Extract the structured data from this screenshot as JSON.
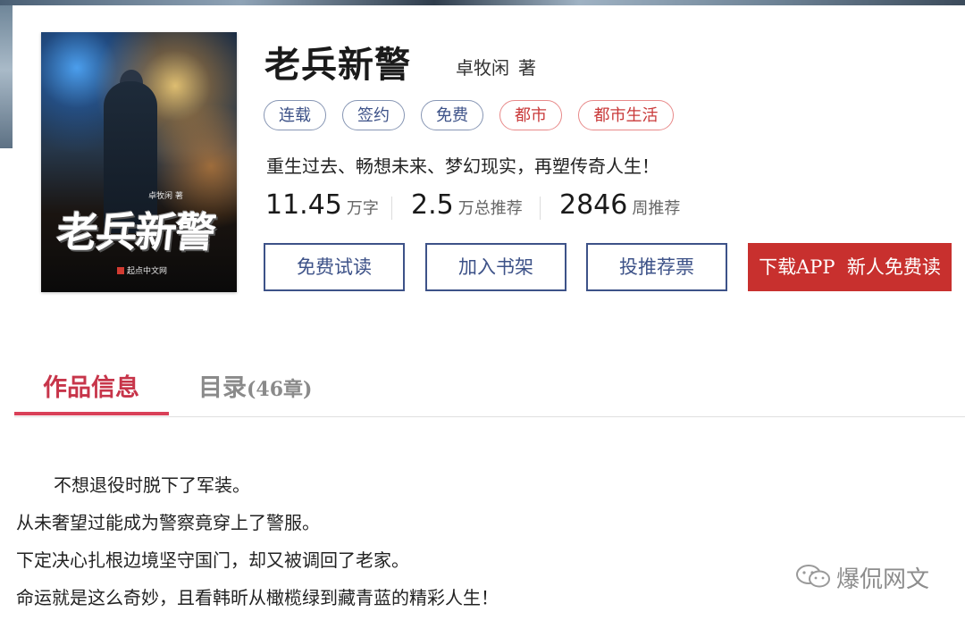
{
  "book": {
    "title": "老兵新警",
    "author": "卓牧闲",
    "author_suffix": "著",
    "intro": "重生过去、畅想未来、梦幻现实，再塑传奇人生！",
    "tags": [
      {
        "label": "连载",
        "style": "blue"
      },
      {
        "label": "签约",
        "style": "blue"
      },
      {
        "label": "免费",
        "style": "blue"
      },
      {
        "label": "都市",
        "style": "red"
      },
      {
        "label": "都市生活",
        "style": "red"
      }
    ],
    "stats": [
      {
        "value": "11.45",
        "unit": "万字"
      },
      {
        "value": "2.5",
        "unit": "万总推荐"
      },
      {
        "value": "2846",
        "unit": "周推荐"
      }
    ]
  },
  "cover": {
    "author": "卓牧闲 著",
    "title": "老兵新警",
    "publisher": "起点中文网"
  },
  "buttons": {
    "trial_read": "免费试读",
    "add_shelf": "加入书架",
    "vote": "投推荐票",
    "download_app": "下载APP  新人免费读"
  },
  "tabs": {
    "info": "作品信息",
    "catalog": "目录",
    "catalog_count": "(46章)"
  },
  "description": [
    "不想退役时脱下了军装。",
    "从未奢望过能成为警察竟穿上了警服。",
    "下定决心扎根边境坚守国门，却又被调回了老家。",
    "命运就是这么奇妙，且看韩昕从橄榄绿到藏青蓝的精彩人生！"
  ],
  "watermark": "爆侃网文",
  "colors": {
    "accent_red": "#c8302e",
    "tab_active": "#d94058",
    "button_blue": "#3d5288",
    "tag_red": "#e88a8a",
    "tag_blue": "#8796b4"
  }
}
